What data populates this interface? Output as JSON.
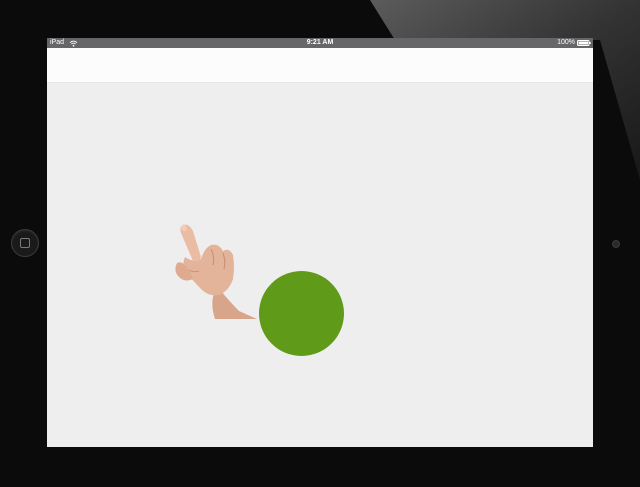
{
  "status_bar": {
    "carrier": "iPad",
    "time": "9:21 AM",
    "battery": "100%",
    "wifi_icon": "wifi-icon",
    "battery_icon": "battery-icon"
  },
  "gesture": {
    "icon": "pointing-hand-icon"
  },
  "colors": {
    "target_circle": "#5f9b18",
    "screen_background": "#efeeef",
    "nav_background": "#fdfcfd",
    "device_bezel": "#0b0b0b"
  }
}
